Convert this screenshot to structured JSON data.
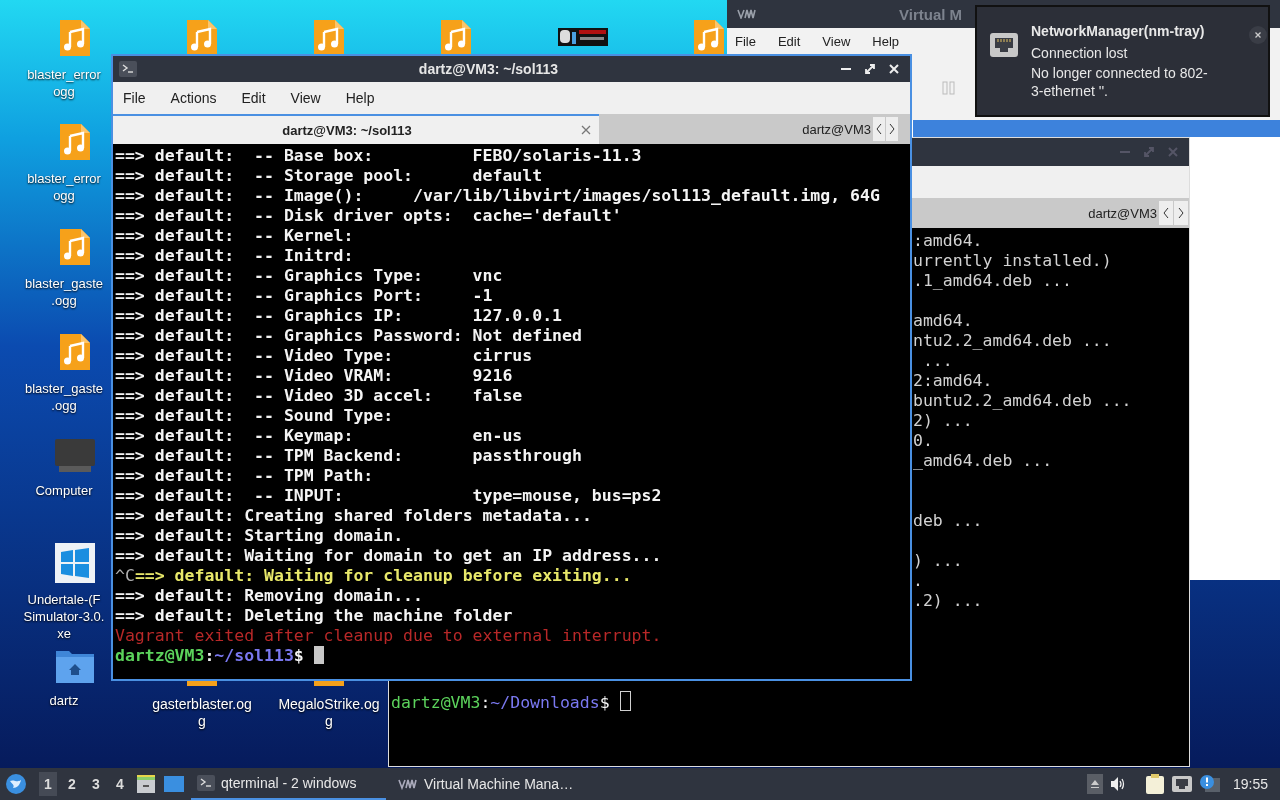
{
  "desktop": {
    "icons": [
      {
        "kind": "audio",
        "label": [
          "blaster_error",
          "ogg"
        ]
      },
      {
        "kind": "audio"
      },
      {
        "kind": "audio"
      },
      {
        "kind": "audio"
      },
      {
        "kind": "picture"
      },
      {
        "kind": "audio"
      },
      {
        "kind": "audio",
        "label": [
          "blaster_error",
          "ogg"
        ]
      },
      {
        "kind": "audio",
        "label": [
          "blaster_gaste",
          ".ogg"
        ]
      },
      {
        "kind": "audio",
        "label": [
          "blaster_gaste",
          ".ogg"
        ]
      },
      {
        "kind": "computer",
        "label": [
          "Computer"
        ]
      },
      {
        "kind": "exe",
        "label": [
          "Undertale-(F",
          "Simulator-3.0.",
          "xe"
        ]
      },
      {
        "kind": "folder",
        "label": [
          "dartz"
        ]
      },
      {
        "kind": "audio",
        "label": [
          "gasterblaster.og",
          "g"
        ]
      },
      {
        "kind": "audio",
        "label": [
          "MegaloStrike.og",
          "g"
        ]
      }
    ]
  },
  "vm_manager": {
    "title": "Virtual M",
    "menu": [
      "File",
      "Edit",
      "View",
      "Help"
    ],
    "rows": [
      {
        "selected": true
      }
    ]
  },
  "back_terminal": {
    "tab": "dartz@VM3",
    "lines": [
      {
        "kind": "output",
        "text": ":amd64."
      },
      {
        "kind": "output",
        "text": "urrently installed.)"
      },
      {
        "kind": "output",
        "text": ".1_amd64.deb ..."
      },
      {
        "kind": "blank"
      },
      {
        "kind": "output",
        "text": "amd64."
      },
      {
        "kind": "output",
        "text": "ntu2.2_amd64.deb ..."
      },
      {
        "kind": "output",
        "text": " ..."
      },
      {
        "kind": "output",
        "text": "2:amd64."
      },
      {
        "kind": "output",
        "text": "buntu2.2_amd64.deb ..."
      },
      {
        "kind": "output",
        "text": "2) ..."
      },
      {
        "kind": "output",
        "text": "0."
      },
      {
        "kind": "output",
        "text": "_amd64.deb ..."
      },
      {
        "kind": "blank"
      },
      {
        "kind": "blank"
      },
      {
        "kind": "output",
        "text": "deb ..."
      },
      {
        "kind": "blank"
      },
      {
        "kind": "output",
        "text": ") ..."
      },
      {
        "kind": "output",
        "text": "."
      },
      {
        "kind": "output",
        "text": ".2) ..."
      },
      {
        "kind": "blank"
      },
      {
        "kind": "blank"
      },
      {
        "kind": "blank"
      },
      {
        "kind": "blank"
      }
    ],
    "prompt": {
      "spans": [
        {
          "text": "dartz@VM3",
          "kind": "user"
        },
        {
          "text": ":",
          "kind": "normal"
        },
        {
          "text": "~/Downloads",
          "kind": "path"
        },
        {
          "text": "$ ",
          "kind": "normal"
        }
      ]
    }
  },
  "front_terminal": {
    "title": "dartz@VM3: ~/sol113",
    "menu": [
      "File",
      "Actions",
      "Edit",
      "View",
      "Help"
    ],
    "tabs": [
      {
        "label": "dartz@VM3: ~/sol113",
        "selected": true
      },
      {
        "label": "dartz@VM3",
        "selected": false
      }
    ],
    "lines": [
      {
        "spans": [
          {
            "text": "==> default:  -- Base box:          FEBO/solaris-11.3",
            "kind": "normal"
          }
        ]
      },
      {
        "spans": [
          {
            "text": "==> default:  -- Storage pool:      default",
            "kind": "normal"
          }
        ]
      },
      {
        "spans": [
          {
            "text": "==> default:  -- Image():     /var/lib/libvirt/images/sol113_default.img, 64G",
            "kind": "normal"
          }
        ]
      },
      {
        "spans": [
          {
            "text": "==> default:  -- Disk driver opts:  cache='default'",
            "kind": "normal"
          }
        ]
      },
      {
        "spans": [
          {
            "text": "==> default:  -- Kernel:",
            "kind": "normal"
          }
        ]
      },
      {
        "spans": [
          {
            "text": "==> default:  -- Initrd:",
            "kind": "normal"
          }
        ]
      },
      {
        "spans": [
          {
            "text": "==> default:  -- Graphics Type:     vnc",
            "kind": "normal"
          }
        ]
      },
      {
        "spans": [
          {
            "text": "==> default:  -- Graphics Port:     -1",
            "kind": "normal"
          }
        ]
      },
      {
        "spans": [
          {
            "text": "==> default:  -- Graphics IP:       127.0.0.1",
            "kind": "normal"
          }
        ]
      },
      {
        "spans": [
          {
            "text": "==> default:  -- Graphics Password: Not defined",
            "kind": "normal"
          }
        ]
      },
      {
        "spans": [
          {
            "text": "==> default:  -- Video Type:        cirrus",
            "kind": "normal"
          }
        ]
      },
      {
        "spans": [
          {
            "text": "==> default:  -- Video VRAM:        9216",
            "kind": "normal"
          }
        ]
      },
      {
        "spans": [
          {
            "text": "==> default:  -- Video 3D accel:    false",
            "kind": "normal"
          }
        ]
      },
      {
        "spans": [
          {
            "text": "==> default:  -- Sound Type:",
            "kind": "normal"
          }
        ]
      },
      {
        "spans": [
          {
            "text": "==> default:  -- Keymap:            en-us",
            "kind": "normal"
          }
        ]
      },
      {
        "spans": [
          {
            "text": "==> default:  -- TPM Backend:       passthrough",
            "kind": "normal"
          }
        ]
      },
      {
        "spans": [
          {
            "text": "==> default:  -- TPM Path:",
            "kind": "normal"
          }
        ]
      },
      {
        "spans": [
          {
            "text": "==> default:  -- INPUT:             type=mouse, bus=ps2",
            "kind": "normal"
          }
        ]
      },
      {
        "spans": [
          {
            "text": "==> default: Creating shared folders metadata...",
            "kind": "normal"
          }
        ]
      },
      {
        "spans": [
          {
            "text": "==> default: Starting domain.",
            "kind": "normal"
          }
        ]
      },
      {
        "spans": [
          {
            "text": "==> default: Waiting for domain to get an IP address...",
            "kind": "normal"
          }
        ]
      },
      {
        "spans": [
          {
            "text": "^C",
            "kind": "dim"
          },
          {
            "text": "==> default: Waiting for cleanup before exiting...",
            "kind": "yellow"
          }
        ]
      },
      {
        "spans": [
          {
            "text": "==> default: Removing domain...",
            "kind": "normal"
          }
        ]
      },
      {
        "spans": [
          {
            "text": "==> default: Deleting the machine folder",
            "kind": "normal"
          }
        ]
      },
      {
        "spans": [
          {
            "text": "Vagrant exited after cleanup due to external interrupt.",
            "kind": "red"
          }
        ]
      },
      {
        "spans": [
          {
            "text": "dartz@VM3",
            "kind": "user"
          },
          {
            "text": ":",
            "kind": "normal"
          },
          {
            "text": "~/sol113",
            "kind": "path"
          },
          {
            "text": "$ ",
            "kind": "normal"
          }
        ]
      }
    ]
  },
  "notification": {
    "title": "NetworkManager(nm-tray)",
    "summary": "Connection lost",
    "body": "No longer connected to 802-3-ethernet ''."
  },
  "taskbar": {
    "workspaces": [
      {
        "label": "1",
        "selected": true
      },
      {
        "label": "2",
        "selected": false
      },
      {
        "label": "3",
        "selected": false
      },
      {
        "label": "4",
        "selected": false
      }
    ],
    "tasks": [
      {
        "kind": "terminal",
        "label": "qterminal - 2 windows",
        "selected": true
      },
      {
        "kind": "vm",
        "label": "Virtual Machine Mana…",
        "selected": false
      }
    ],
    "clock": "19:55"
  }
}
